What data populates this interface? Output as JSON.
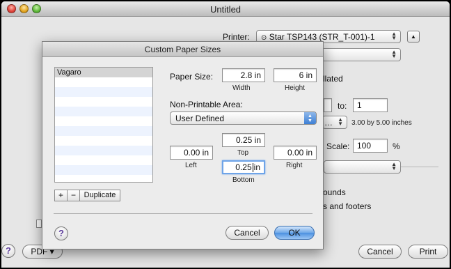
{
  "window": {
    "title": "Untitled"
  },
  "print_sheet": {
    "printer_label": "Printer:",
    "printer_value": "Star TSP143 (STR_T-001)-1",
    "collated_partial": "llated",
    "to_label": "to:",
    "to_value": "1",
    "paper_dims_text": "3.00 by 5.00 inches",
    "scale_label": "Scale:",
    "scale_value": "100",
    "scale_unit": "%",
    "rounds_partial": "ounds",
    "footers_partial": "s and footers",
    "pdf_label": "PDF ▾",
    "cancel_label": "Cancel",
    "print_label": "Print",
    "help_label": "?"
  },
  "dialog": {
    "title": "Custom Paper Sizes",
    "list_items": [
      "Vagaro"
    ],
    "add_label": "+",
    "remove_label": "−",
    "duplicate_label": "Duplicate",
    "paper_size_label": "Paper Size:",
    "width_value": "2.8 in",
    "height_value": "6 in",
    "width_label": "Width",
    "height_label": "Height",
    "non_printable_label": "Non-Printable Area:",
    "non_printable_value": "User Defined",
    "top_value": "0.25 in",
    "top_label": "Top",
    "left_value": "0.00 in",
    "left_label": "Left",
    "right_value": "0.00 in",
    "right_label": "Right",
    "bottom_value_num": "0.25",
    "bottom_value_unit": "in",
    "bottom_label": "Bottom",
    "help_label": "?",
    "cancel_label": "Cancel",
    "ok_label": "OK"
  }
}
